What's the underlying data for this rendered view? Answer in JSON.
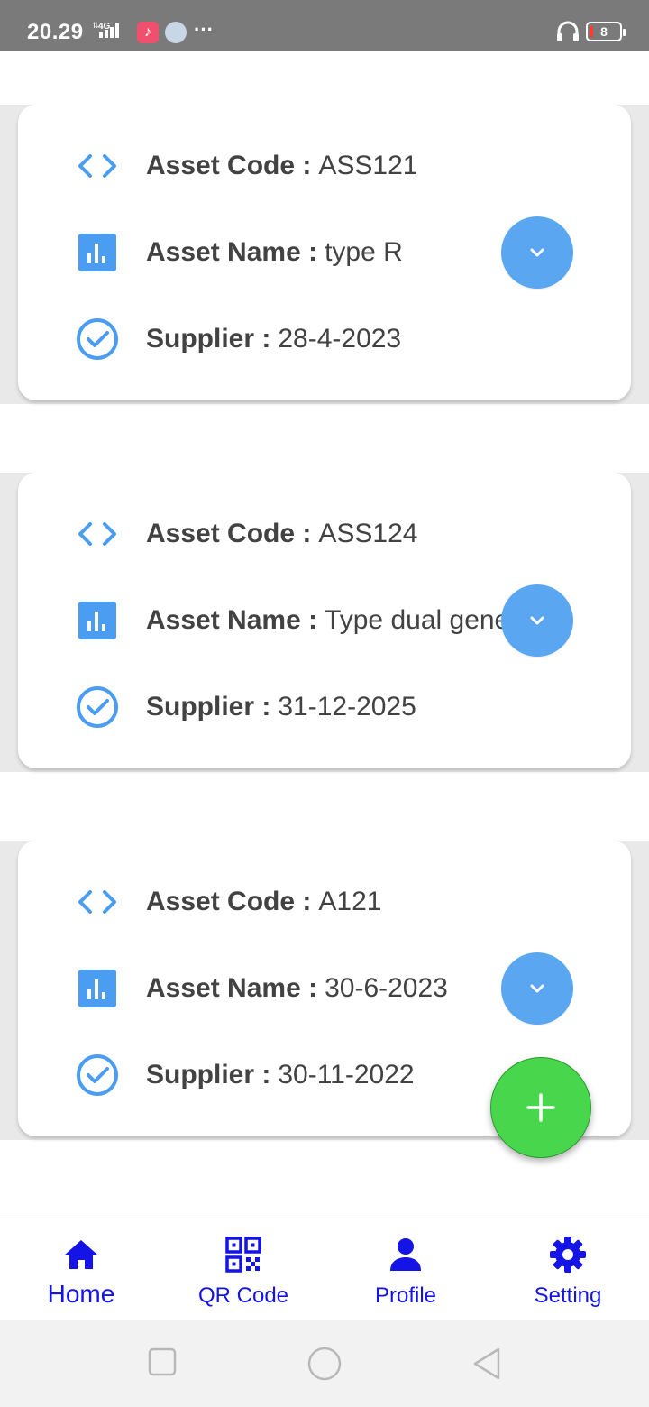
{
  "status_bar": {
    "time": "20.29",
    "network": "4G",
    "battery": "8",
    "more": "···"
  },
  "assets": [
    {
      "code_label": "Asset Code :",
      "code": "ASS121",
      "name_label": "Asset Name :",
      "name": "type R",
      "supplier_label": "Supplier :",
      "supplier": "28-4-2023"
    },
    {
      "code_label": "Asset Code :",
      "code": "ASS124",
      "name_label": "Asset Name :",
      "name": "Type dual generator",
      "supplier_label": "Supplier :",
      "supplier": "31-12-2025"
    },
    {
      "code_label": "Asset Code :",
      "code": "A121",
      "name_label": "Asset Name :",
      "name": "30-6-2023",
      "supplier_label": "Supplier :",
      "supplier": "30-11-2022"
    }
  ],
  "bottom_nav": {
    "items": [
      {
        "label": "Home",
        "icon": "home-icon"
      },
      {
        "label": "QR Code",
        "icon": "qr-code-icon"
      },
      {
        "label": "Profile",
        "icon": "person-icon"
      },
      {
        "label": "Setting",
        "icon": "gear-icon"
      }
    ]
  },
  "colors": {
    "accent_blue": "#5aa6f0",
    "fab_green": "#48d64c",
    "nav_blue": "#1414e6",
    "text": "#424242"
  }
}
